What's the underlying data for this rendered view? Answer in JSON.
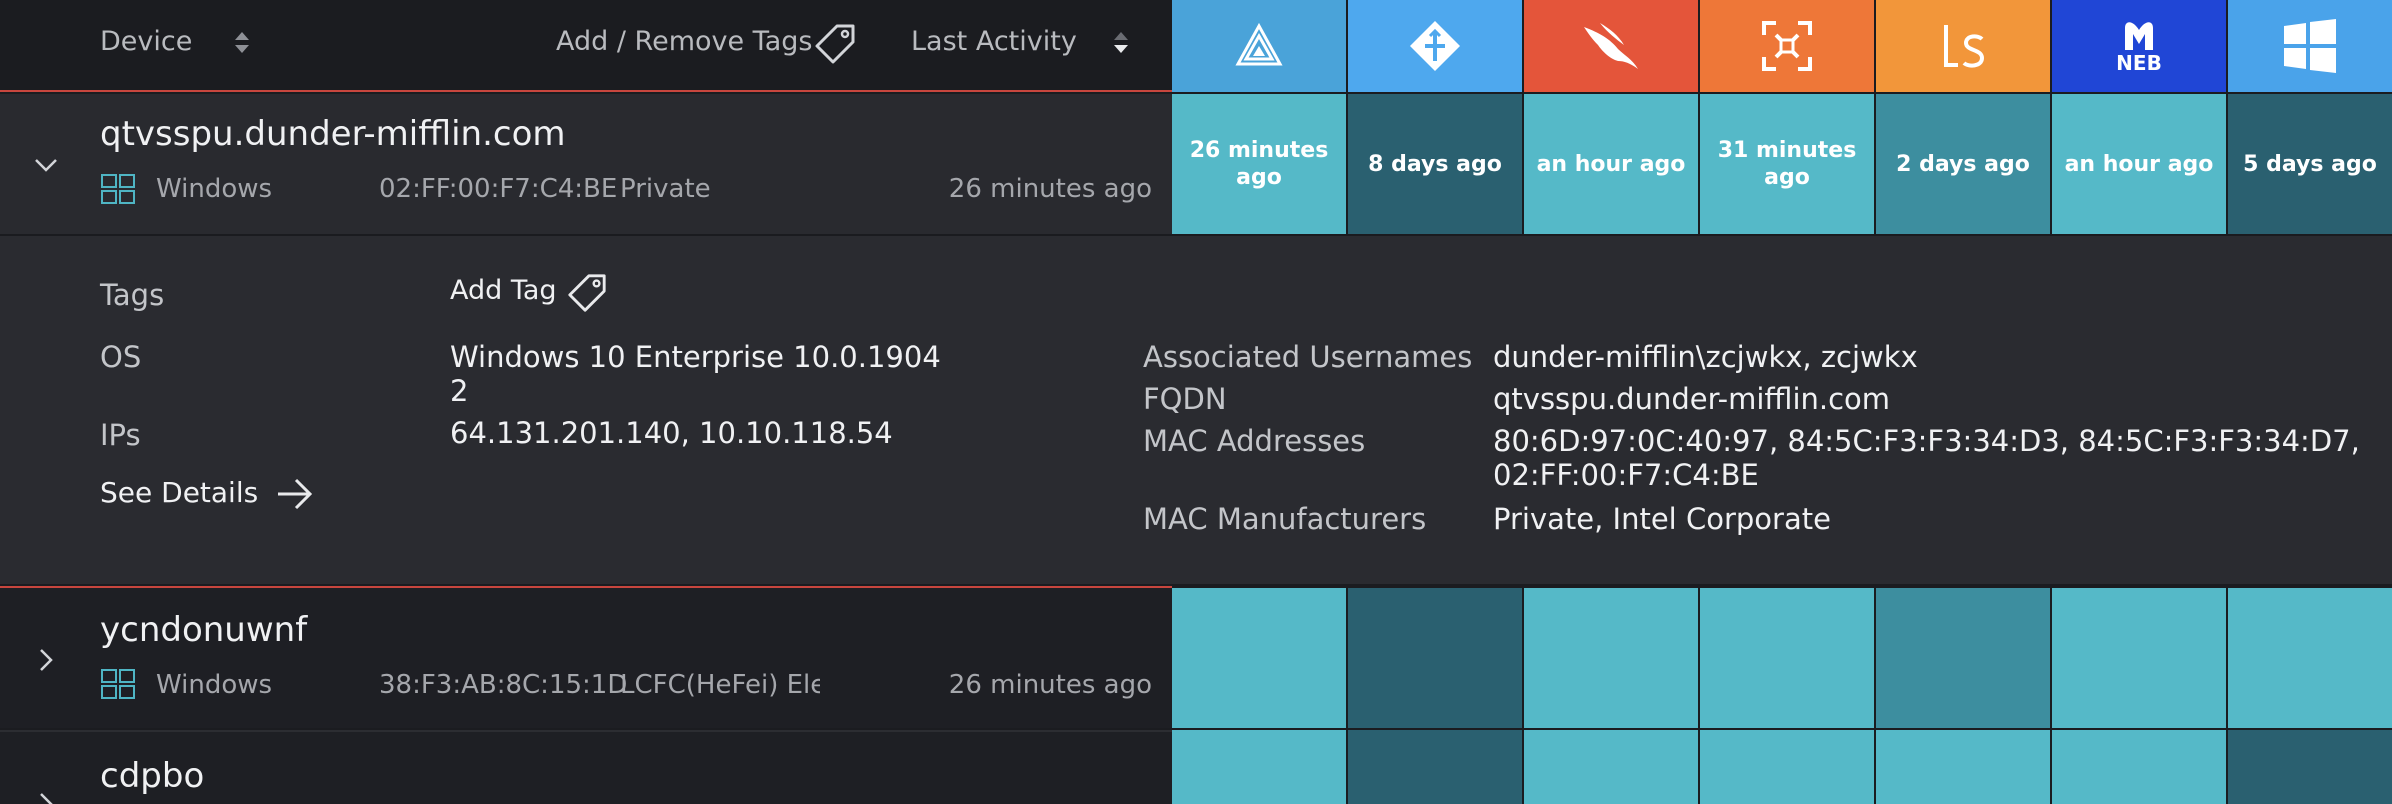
{
  "header": {
    "device_label": "Device",
    "tags_label": "Add / Remove Tags",
    "activity_label": "Last Activity"
  },
  "sources": [
    {
      "name": "arrow-triangle",
      "icon": "prism-logo-icon",
      "color": "#4aa3d9"
    },
    {
      "name": "diamond-sync",
      "icon": "diamond-arrows-logo-icon",
      "color": "#4ea8ee"
    },
    {
      "name": "crowdstrike",
      "icon": "falcon-bird-logo-icon",
      "color": "#e4553a"
    },
    {
      "name": "scan",
      "icon": "scan-frame-logo-icon",
      "color": "#ee7738"
    },
    {
      "name": "ls",
      "icon": "ls-logo-icon",
      "color": "#f2963a"
    },
    {
      "name": "malwarebytes",
      "icon": "neb-logo-icon",
      "color": "#2046d6",
      "label": "NEB"
    },
    {
      "name": "windows",
      "icon": "windows-logo-icon",
      "color": "#4aa3ea"
    }
  ],
  "devices": [
    {
      "hostname": "qtvsspu.dunder-mifflin.com",
      "os": "Windows",
      "mac": "02:FF:00:F7:C4:BE",
      "manufacturer": "Private",
      "last_activity": "26 minutes ago",
      "cells": [
        {
          "text": "26 minutes ago",
          "tone": "light"
        },
        {
          "text": "8 days ago",
          "tone": "dark"
        },
        {
          "text": "an hour ago",
          "tone": "light"
        },
        {
          "text": "31 minutes ago",
          "tone": "light"
        },
        {
          "text": "2 days ago",
          "tone": "mid"
        },
        {
          "text": "an hour ago",
          "tone": "light"
        },
        {
          "text": "5 days ago",
          "tone": "dark"
        }
      ]
    },
    {
      "hostname": "ycndonuwnf",
      "os": "Windows",
      "mac": "38:F3:AB:8C:15:1D",
      "manufacturer": "LCFC(HeFei) Electronics Technology Co., Ltd.",
      "last_activity": "26 minutes ago",
      "cells": [
        {
          "tone": "light"
        },
        {
          "tone": "dark"
        },
        {
          "tone": "light"
        },
        {
          "tone": "light"
        },
        {
          "tone": "mid"
        },
        {
          "tone": "light"
        },
        {
          "tone": "light"
        }
      ]
    },
    {
      "hostname": "cdpbo",
      "cells": [
        {
          "tone": "light"
        },
        {
          "tone": "dark"
        },
        {
          "tone": "light"
        },
        {
          "tone": "light"
        },
        {
          "tone": "light"
        },
        {
          "tone": "light"
        },
        {
          "tone": "dark"
        }
      ]
    }
  ],
  "details": {
    "tags_label": "Tags",
    "add_tag": "Add Tag",
    "os_label": "OS",
    "os_value_1": "Windows 10 Enterprise 10.0.1904",
    "os_value_2": "2",
    "ips_label": "IPs",
    "ips_value": "64.131.201.140, 10.10.118.54",
    "see_details": "See Details",
    "usernames_label": "Associated Usernames",
    "usernames_value": "dunder-mifflin\\zcjwkx, zcjwkx",
    "fqdn_label": "FQDN",
    "fqdn_value": "qtvsspu.dunder-mifflin.com",
    "mac_label": "MAC Addresses",
    "mac_value_1": "80:6D:97:0C:40:97, 84:5C:F3:F3:34:D3, 84:5C:F3:F3:34:D7,",
    "mac_value_2": "02:FF:00:F7:C4:BE",
    "manufacturers_label": "MAC Manufacturers",
    "manufacturers_value": "Private, Intel Corporate"
  },
  "colors": {
    "cell_light": "#55b9c8",
    "cell_mid": "#3d8e9f",
    "cell_dark": "#2a6070",
    "accent_line": "#c8463e",
    "windows_icon": "#4fb5c4"
  }
}
